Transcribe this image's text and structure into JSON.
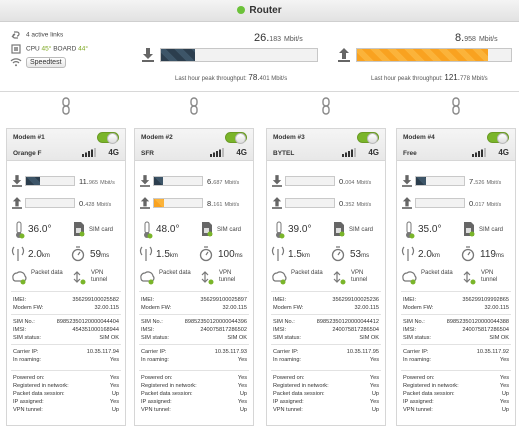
{
  "header": {
    "title": "Router"
  },
  "summary": {
    "links": "4 active links",
    "cpu_label": "CPU",
    "cpu_temp": "45°",
    "board_label": "BOARD",
    "board_temp": "44°",
    "speedtest_label": "Speedtest"
  },
  "download": {
    "value": "26.",
    "value_frac": "183",
    "unit": "Mbit/s",
    "fill": 0.22,
    "peak_label": "Last hour peak throughput:",
    "peak_value": "78.",
    "peak_frac": "401",
    "peak_unit": "Mbit/s"
  },
  "upload": {
    "value": "8.",
    "value_frac": "958",
    "unit": "Mbit/s",
    "fill": 0.85,
    "peak_label": "Last hour peak throughput:",
    "peak_value": "121.",
    "peak_frac": "778",
    "peak_unit": "Mbit/s"
  },
  "colors": {
    "accent_green": "#6cc23a",
    "download_fill": "#2c3e4e",
    "upload_fill": "#f9a220",
    "ok_green": "#7ab52a"
  },
  "modems": [
    {
      "title": "Modem #1",
      "operator": "Orange F",
      "network": "4G",
      "dl_int": "11.",
      "dl_frac": "965",
      "dl_unit": "Mbit/s",
      "dl_fill": 0.3,
      "ul_int": "0.",
      "ul_frac": "428",
      "ul_unit": "Mbit/s",
      "ul_fill": 0,
      "temp": "36.0°",
      "sim_label": "SIM card",
      "distance": "2.0",
      "distance_unit": "km",
      "latency": "59",
      "latency_unit": "ms",
      "packet_label": "Packet data",
      "vpn_label": "VPN tunnel",
      "imei_k": "IMEI:",
      "imei": "356299100025582",
      "fw_k": "Modem FW:",
      "fw": "32.00.115",
      "simno_k": "SIM No.:",
      "simno": "89852350120000044404",
      "imsi_k": "IMSI:",
      "imsi": "454351000168944",
      "simstatus_k": "SIM status:",
      "simstatus": "SIM OK",
      "carrier_k": "Carrier IP:",
      "carrier": "10.35.117.94",
      "roaming_k": "In roaming:",
      "roaming": "Yes",
      "powered_k": "Powered on:",
      "powered": "Yes",
      "registered_k": "Registered in network:",
      "registered": "Yes",
      "pds_k": "Packet data session:",
      "pds": "Up",
      "ipa_k": "IP assigned:",
      "ipa": "Yes",
      "vpn_k": "VPN tunnel:",
      "vpn": "Up"
    },
    {
      "title": "Modem #2",
      "operator": "SFR",
      "network": "4G",
      "dl_int": "6.",
      "dl_frac": "687",
      "dl_unit": "Mbit/s",
      "dl_fill": 0.18,
      "ul_int": "8.",
      "ul_frac": "161",
      "ul_unit": "Mbit/s",
      "ul_fill": 0.2,
      "temp": "48.0°",
      "sim_label": "SIM card",
      "distance": "1.5",
      "distance_unit": "km",
      "latency": "100",
      "latency_unit": "ms",
      "packet_label": "Packet data",
      "vpn_label": "VPN tunnel",
      "imei_k": "IMEI:",
      "imei": "356299100025897",
      "fw_k": "Modem FW:",
      "fw": "32.00.115",
      "simno_k": "SIM No.:",
      "simno": "89852350120000044396",
      "imsi_k": "IMSI:",
      "imsi": "240075817286502",
      "simstatus_k": "SIM status:",
      "simstatus": "SIM OK",
      "carrier_k": "Carrier IP:",
      "carrier": "10.35.117.93",
      "roaming_k": "In roaming:",
      "roaming": "Yes",
      "powered_k": "Powered on:",
      "powered": "Yes",
      "registered_k": "Registered in network:",
      "registered": "Yes",
      "pds_k": "Packet data session:",
      "pds": "Up",
      "ipa_k": "IP assigned:",
      "ipa": "Yes",
      "vpn_k": "VPN tunnel:",
      "vpn": "Up"
    },
    {
      "title": "Modem #3",
      "operator": "BYTEL",
      "network": "4G",
      "dl_int": "0.",
      "dl_frac": "004",
      "dl_unit": "Mbit/s",
      "dl_fill": 0,
      "ul_int": "0.",
      "ul_frac": "352",
      "ul_unit": "Mbit/s",
      "ul_fill": 0,
      "temp": "39.0°",
      "sim_label": "SIM card",
      "distance": "1.5",
      "distance_unit": "km",
      "latency": "53",
      "latency_unit": "ms",
      "packet_label": "Packet data",
      "vpn_label": "VPN tunnel",
      "imei_k": "IMEI:",
      "imei": "356299100025236",
      "fw_k": "Modem FW:",
      "fw": "32.00.115",
      "simno_k": "SIM No.:",
      "simno": "89852350120000044412",
      "imsi_k": "IMSI:",
      "imsi": "240075817286504",
      "simstatus_k": "SIM status:",
      "simstatus": "SIM OK",
      "carrier_k": "Carrier IP:",
      "carrier": "10.35.117.95",
      "roaming_k": "In roaming:",
      "roaming": "Yes",
      "powered_k": "Powered on:",
      "powered": "Yes",
      "registered_k": "Registered in network:",
      "registered": "Yes",
      "pds_k": "Packet data session:",
      "pds": "Up",
      "ipa_k": "IP assigned:",
      "ipa": "Yes",
      "vpn_k": "VPN tunnel:",
      "vpn": "Up"
    },
    {
      "title": "Modem #4",
      "operator": "Free",
      "network": "4G",
      "dl_int": "7.",
      "dl_frac": "526",
      "dl_unit": "Mbit/s",
      "dl_fill": 0.2,
      "ul_int": "0.",
      "ul_frac": "017",
      "ul_unit": "Mbit/s",
      "ul_fill": 0,
      "temp": "35.0°",
      "sim_label": "SIM card",
      "distance": "2.0",
      "distance_unit": "km",
      "latency": "119",
      "latency_unit": "ms",
      "packet_label": "Packet data",
      "vpn_label": "VPN tunnel",
      "imei_k": "IMEI:",
      "imei": "356299109992865",
      "fw_k": "Modem FW:",
      "fw": "32.00.115",
      "simno_k": "SIM No.:",
      "simno": "89852350120000044388",
      "imsi_k": "IMSI:",
      "imsi": "240075817286504",
      "simstatus_k": "SIM status:",
      "simstatus": "SIM OK",
      "carrier_k": "Carrier IP:",
      "carrier": "10.35.117.92",
      "roaming_k": "In roaming:",
      "roaming": "Yes",
      "powered_k": "Powered on:",
      "powered": "Yes",
      "registered_k": "Registered in network:",
      "registered": "Yes",
      "pds_k": "Packet data session:",
      "pds": "Up",
      "ipa_k": "IP assigned:",
      "ipa": "Yes",
      "vpn_k": "VPN tunnel:",
      "vpn": "Up"
    }
  ]
}
